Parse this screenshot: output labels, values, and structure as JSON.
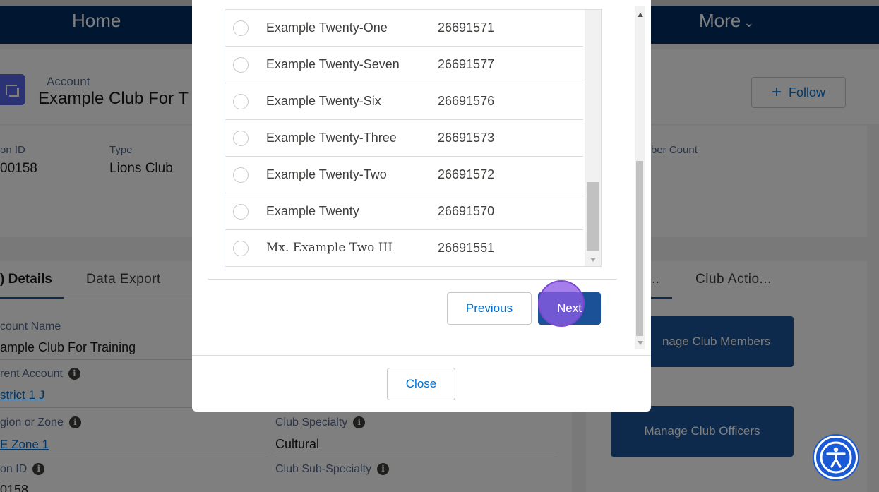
{
  "nav": {
    "home_label": "Home",
    "more_label": "More",
    "more_chevron": "⌄"
  },
  "header": {
    "object_label": "Account",
    "account_name": "Example Club For T",
    "follow_label": "Follow",
    "follow_icon": "+"
  },
  "highlights": {
    "fields": [
      {
        "label": "on ID",
        "value": "00158"
      },
      {
        "label": "Type",
        "value": "Lions Club"
      },
      {
        "label": "ber Count",
        "value": ""
      }
    ]
  },
  "details": {
    "tabs": {
      "details": "Details",
      "export": "Data Export"
    },
    "fields": {
      "account_name_label": "count Name",
      "account_name_value": "ample Club For Training",
      "parent_account_label": "rent Account",
      "parent_account_value": "strict 1 J",
      "region_label": "gion or Zone",
      "region_value": "E Zone 1",
      "club_specialty_label": "Club Specialty",
      "club_specialty_value": "Cultural",
      "lion_id_label": "on ID",
      "lion_id_value": "0158",
      "club_sub_specialty_label": "Club Sub-Specialty"
    }
  },
  "actions": {
    "tabs": {
      "related": "...",
      "club_actions": "Club Actio..."
    },
    "manage_members": "nage Club Members",
    "manage_officers": "Manage Club Officers"
  },
  "modal": {
    "rows": [
      {
        "name": "Example Twenty-One",
        "number": "26691571"
      },
      {
        "name": "Example Twenty-Seven",
        "number": "26691577"
      },
      {
        "name": "Example Twenty-Six",
        "number": "26691576"
      },
      {
        "name": "Example Twenty-Three",
        "number": "26691573"
      },
      {
        "name": "Example Twenty-Two",
        "number": "26691572"
      },
      {
        "name": "Example Twenty",
        "number": "26691570"
      },
      {
        "name": "Mx. Example Two III",
        "number": "26691551"
      }
    ],
    "previous_label": "Previous",
    "next_label": "Next",
    "close_label": "Close"
  },
  "colors": {
    "nav_bg": "#032d60",
    "brand_button": "#1b5297",
    "link": "#0070d2",
    "click_indicator": "#8c5ae6",
    "accessibility_button": "#1a5ad6"
  },
  "icons": {
    "info": "i",
    "accessibility": "accessibility-icon"
  }
}
